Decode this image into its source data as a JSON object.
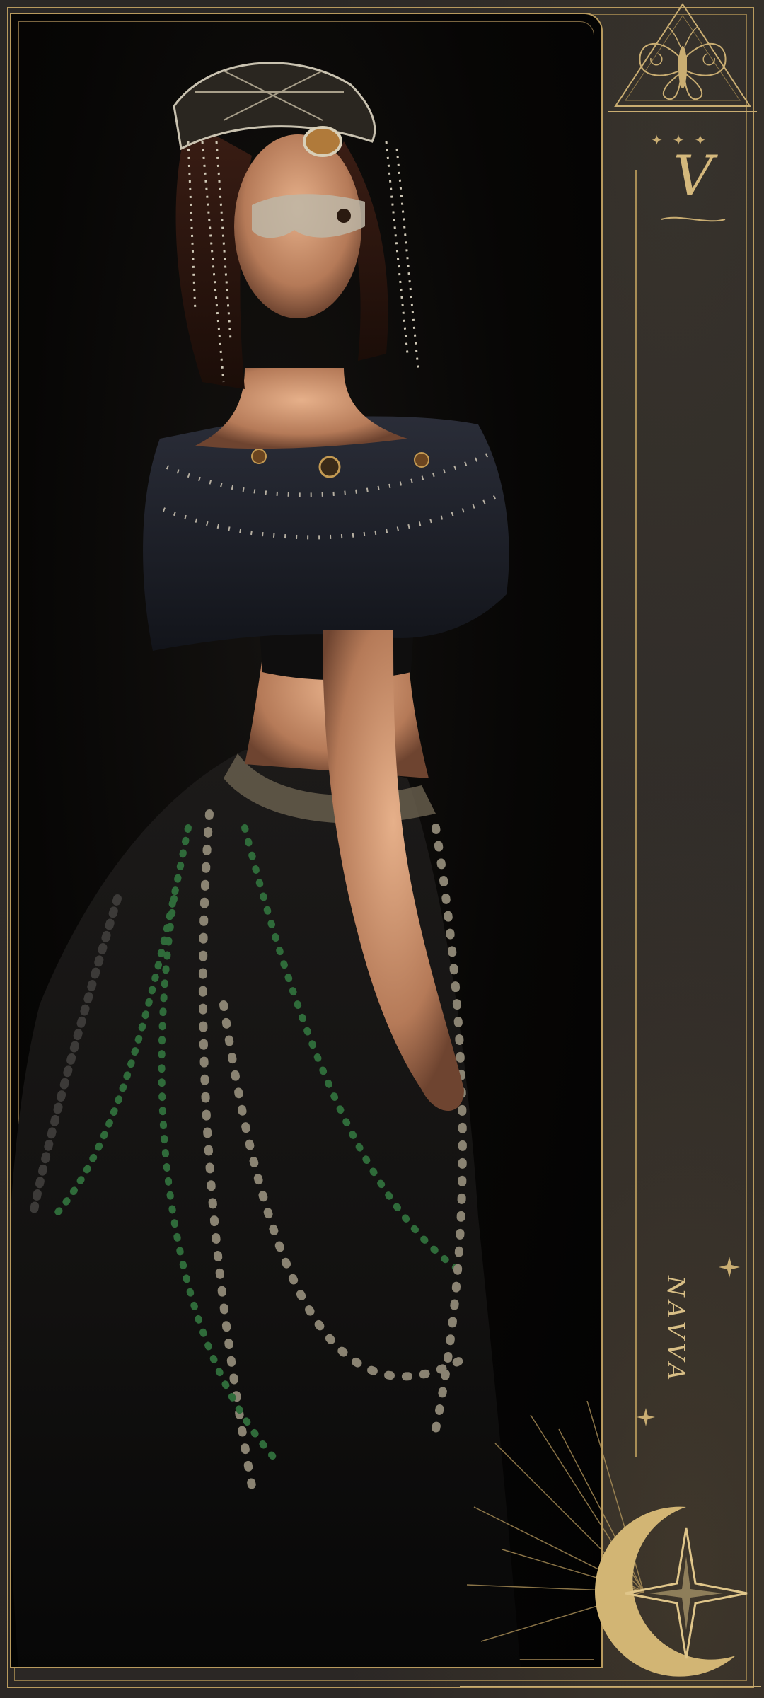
{
  "card": {
    "monogram": "V",
    "vertical_name": "NAVVA",
    "top_stars": "✦✦✦",
    "colors": {
      "gold": "#c9ad72",
      "gold_dark": "#8f7849",
      "background": "#2b2826",
      "panel": "#070605"
    }
  },
  "icons": {
    "top_right": "moth-emblem-icon",
    "bottom_right": "crescent-moon-star-icon",
    "sparkle": "sparkle-star-icon"
  }
}
